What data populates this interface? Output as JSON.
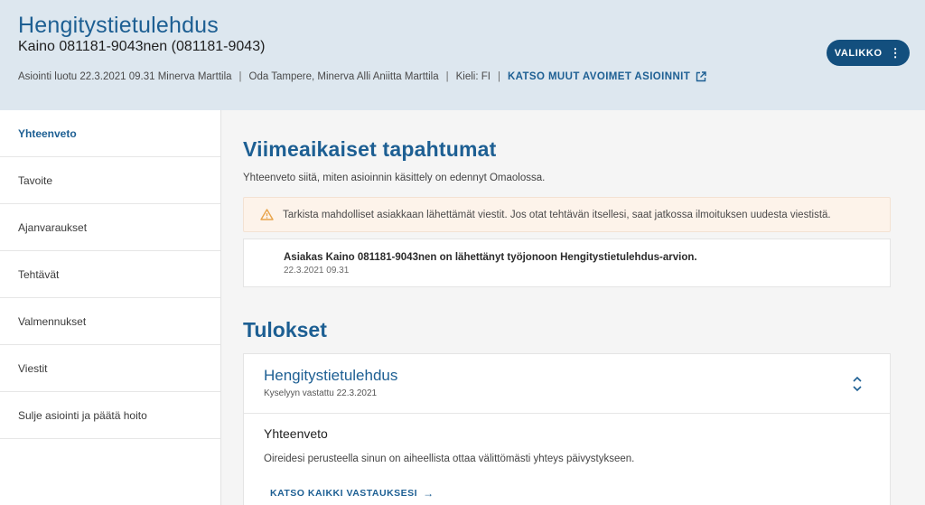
{
  "header": {
    "title": "Hengitystietulehdus",
    "subtitle": "Kaino 081181-9043nen (081181-9043)",
    "meta": {
      "created": "Asiointi luotu 22.3.2021 09.31 Minerva Marttila",
      "unit": "Oda Tampere, Minerva Alli Aniitta Marttila",
      "language": "Kieli: FI",
      "separator": "|",
      "other_link": "KATSO MUUT AVOIMET ASIOINNIT"
    },
    "menu_label": "VALIKKO",
    "menu_dots": "⋮"
  },
  "sidebar": {
    "items": [
      {
        "label": "Yhteenveto",
        "active": true
      },
      {
        "label": "Tavoite"
      },
      {
        "label": "Ajanvaraukset"
      },
      {
        "label": "Tehtävät"
      },
      {
        "label": "Valmennukset"
      },
      {
        "label": "Viestit"
      },
      {
        "label": "Sulje asiointi ja päätä hoito"
      }
    ]
  },
  "recent": {
    "title": "Viimeaikaiset tapahtumat",
    "lead": "Yhteenveto siitä, miten asioinnin käsittely on edennyt Omaolossa.",
    "alert": "Tarkista mahdolliset asiakkaan lähettämät viestit. Jos otat tehtävän itsellesi, saat jatkossa ilmoituksen uudesta viestistä.",
    "event": {
      "title": "Asiakas Kaino 081181-9043nen on lähettänyt työjonoon Hengitystietulehdus-arvion.",
      "date": "22.3.2021 09.31"
    }
  },
  "results": {
    "title": "Tulokset",
    "card": {
      "title": "Hengitystietulehdus",
      "answered": "Kyselyyn vastattu 22.3.2021",
      "summary_title": "Yhteenveto",
      "summary_text": "Oireidesi perusteella sinun on aiheellista ottaa välittömästi yhteys päivystykseen.",
      "link": "KATSO KAIKKI VASTAUKSESI",
      "link_arrow": "→"
    }
  },
  "colors": {
    "brand": "#1d5f93",
    "button": "#134f7e",
    "header_bg": "#dde7ef",
    "alert_bg": "#fdf3ea",
    "warning": "#e8a34a"
  }
}
